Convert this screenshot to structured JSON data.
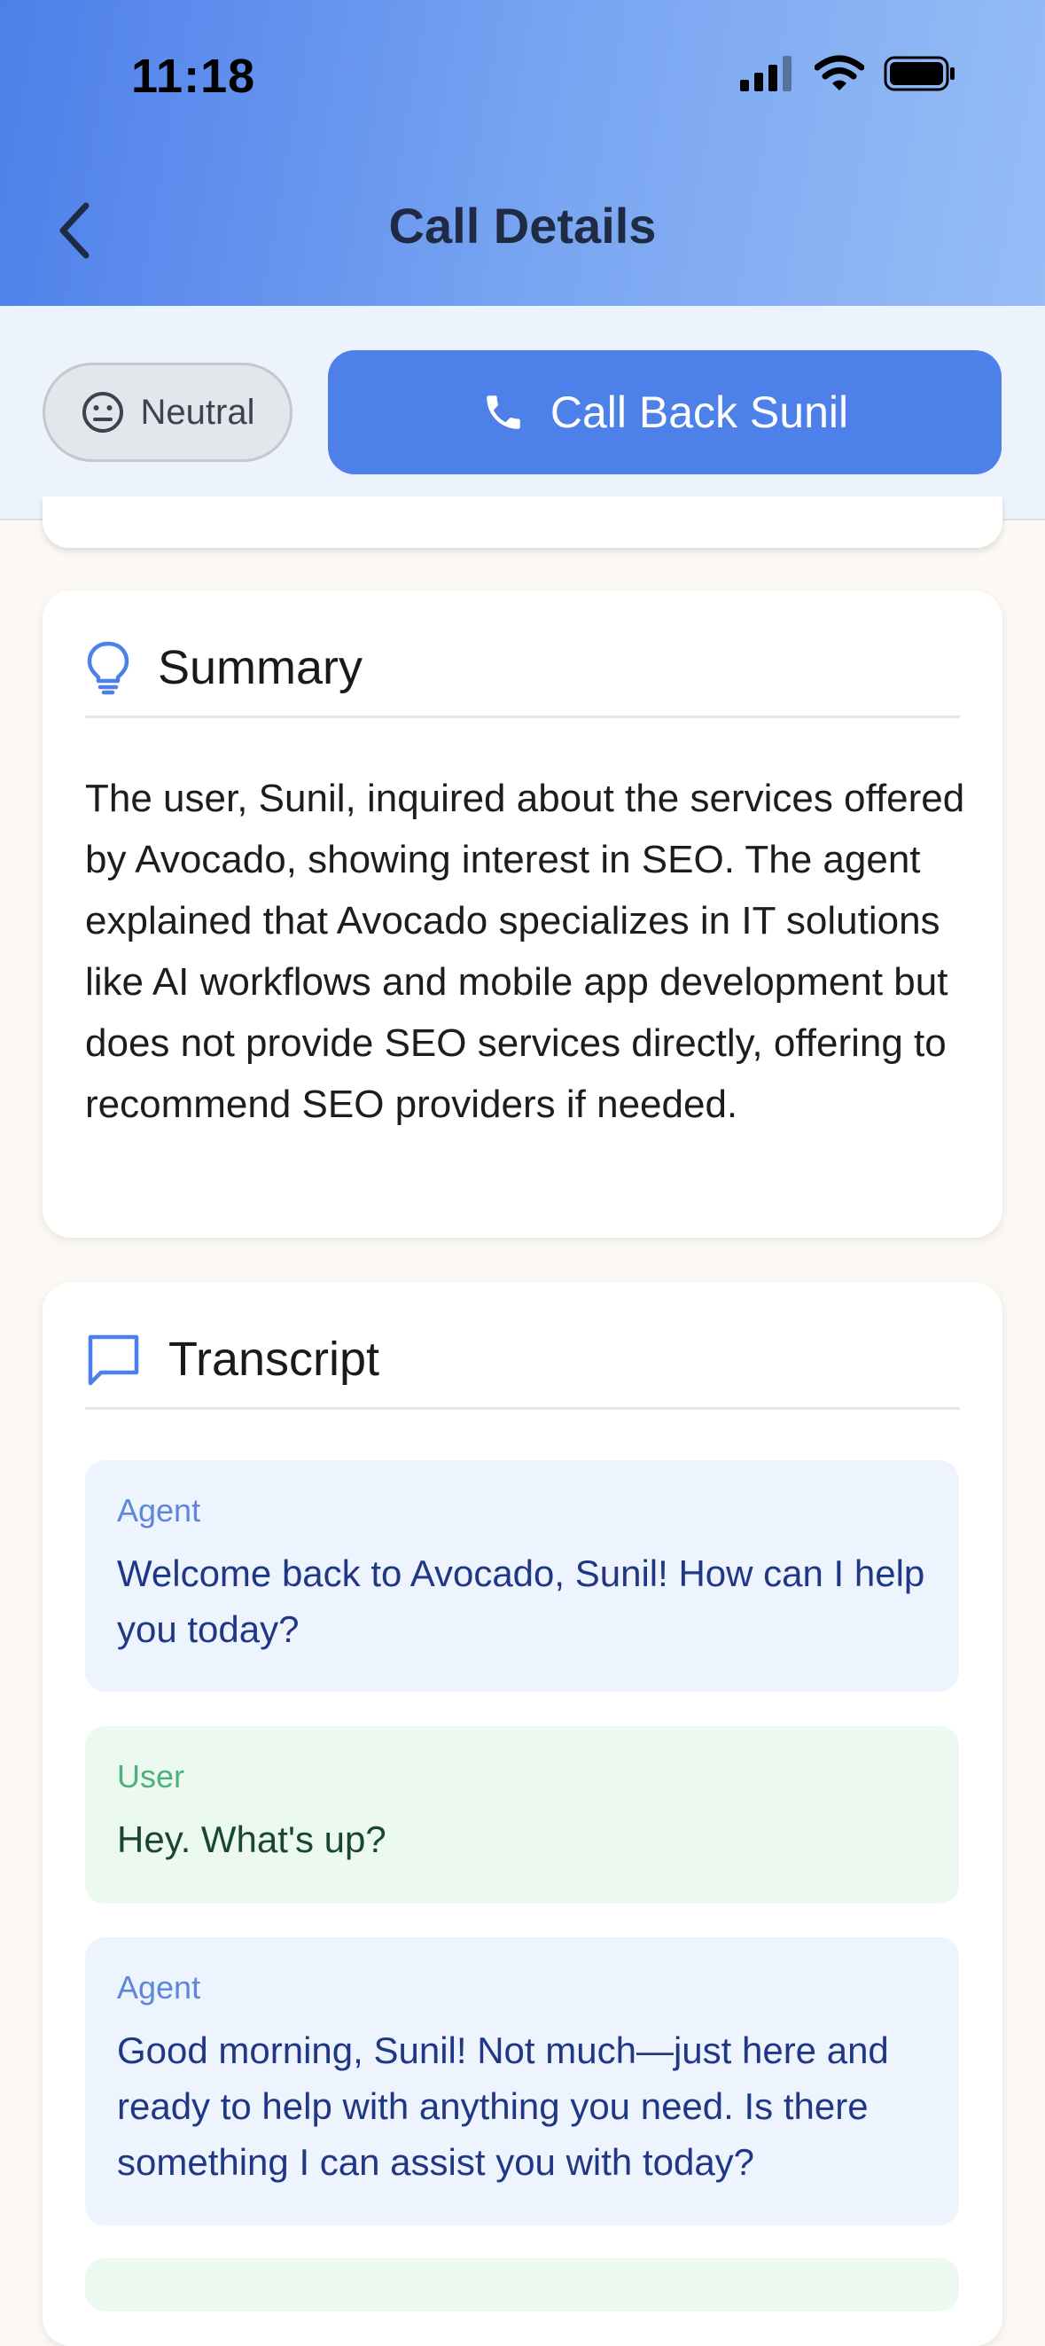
{
  "status_bar": {
    "time": "11:18",
    "icons": [
      "cellular-signal-icon",
      "wifi-icon",
      "battery-icon"
    ]
  },
  "nav": {
    "title": "Call Details",
    "back_icon": "chevron-left-icon"
  },
  "actions": {
    "sentiment": {
      "label": "Neutral",
      "icon": "neutral-face-icon"
    },
    "call_back": {
      "label": "Call Back Sunil",
      "icon": "phone-icon"
    }
  },
  "summary": {
    "title": "Summary",
    "icon": "lightbulb-icon",
    "text": "The user, Sunil, inquired about the services offered by Avocado, showing interest in SEO. The agent explained that Avocado specializes in IT solutions like AI workflows and mobile app development but does not provide SEO services directly, offering to recommend SEO providers if needed."
  },
  "transcript": {
    "title": "Transcript",
    "icon": "chat-bubble-icon",
    "messages": [
      {
        "role": "Agent",
        "text": "Welcome back to Avocado, Sunil! How can I help you today?"
      },
      {
        "role": "User",
        "text": "Hey. What's up?"
      },
      {
        "role": "Agent",
        "text": "Good morning, Sunil! Not much—just here and ready to help with anything you need. Is there something I can assist you with today?"
      }
    ]
  },
  "colors": {
    "header_gradient_start": "#4d7fea",
    "header_gradient_end": "#96bdf6",
    "accent_blue": "#4e80ea",
    "agent_bubble": "#eef4fd",
    "user_bubble": "#ecf9f1",
    "agent_role": "#5d86dc",
    "user_role": "#4fb17a"
  }
}
